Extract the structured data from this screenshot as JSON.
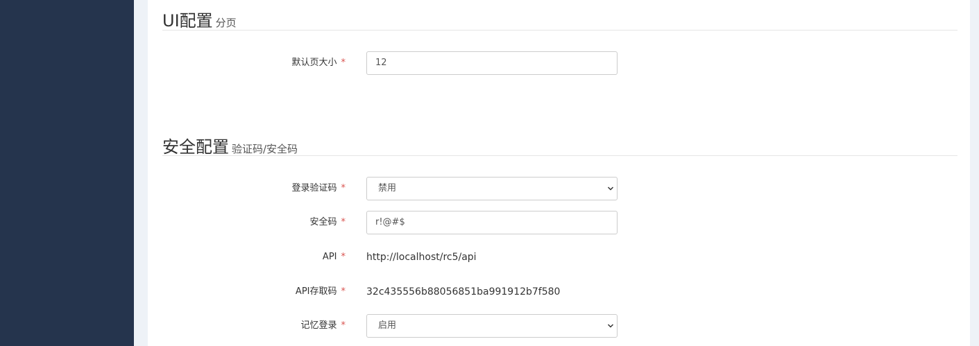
{
  "ui_section": {
    "title": "UI配置",
    "subtitle": "分页",
    "fields": {
      "page_size": {
        "label": "默认页大小",
        "required_mark": "*",
        "value": "12"
      }
    }
  },
  "security_section": {
    "title": "安全配置",
    "subtitle": "验证码/安全码",
    "fields": {
      "login_captcha": {
        "label": "登录验证码",
        "required_mark": "*",
        "value": "禁用"
      },
      "security_code": {
        "label": "安全码",
        "required_mark": "*",
        "value": "r!@#$"
      },
      "api": {
        "label": "API",
        "required_mark": "*",
        "value": "http://localhost/rc5/api"
      },
      "api_access_code": {
        "label": "API存取码",
        "required_mark": "*",
        "value": "32c435556b88056851ba991912b7f580"
      },
      "remember_login": {
        "label": "记忆登录",
        "required_mark": "*",
        "value": "启用"
      }
    }
  },
  "colors": {
    "sidebar": "#25344d",
    "background": "#eef2f7",
    "required": "#d9534f"
  },
  "icons": {
    "select_arrow": "chevron-down-icon"
  }
}
